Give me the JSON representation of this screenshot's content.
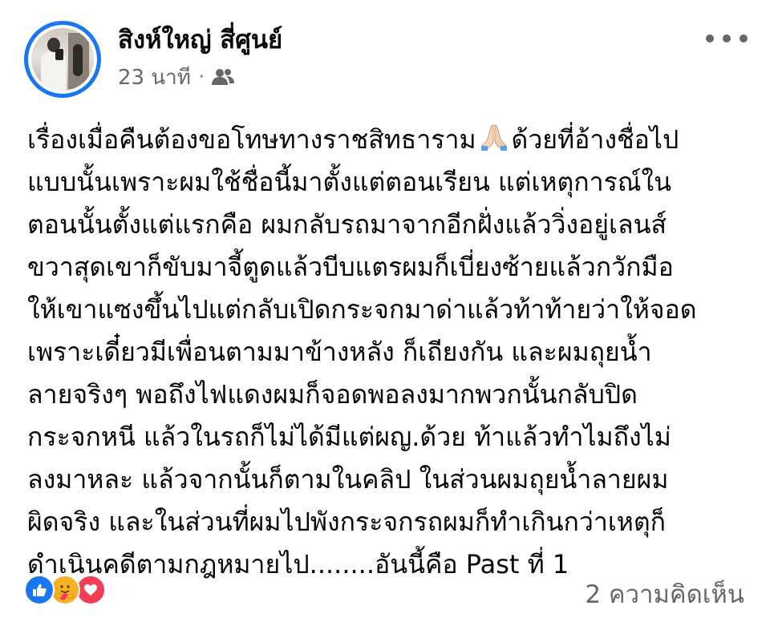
{
  "post": {
    "author": "สิงห์ใหญ่ สี่ศูนย์",
    "time": "23 นาที",
    "separator": "·",
    "audience_icon": "friends-icon",
    "more_icon": "more-horizontal-icon",
    "lines": [
      {
        "before": "เรื่องเมื่อคืนต้องขอโทษทางราชสิทธาราม",
        "emoji": "folded-hands-icon",
        "after": "ด้วยที่อ้างชื่อไป"
      },
      {
        "text": "แบบนั้นเพราะผมใช้ชื่อนี้มาตั้งแต่ตอนเรียน แต่เหตุการณ์ใน"
      },
      {
        "text": "ตอนนั้นตั้งแต่แรกคือ ผมกลับรถมาจากอีกฝั่งแล้ววิ่งอยู่เลนส์"
      },
      {
        "text": "ขวาสุดเขาก็ขับมาจี้ตูดแล้วบีบแตรผมก็เบี่ยงซ้ายแล้วกวักมือ"
      },
      {
        "text": "ให้เขาแซงขึ้นไปแต่กลับเปิดกระจกมาด่าแล้วท้าท้ายว่าให้จอด"
      },
      {
        "text": "เพราะเดี๋ยวมีเพื่อนตามมาข้างหลัง ก็เถียงกัน และผมถุยน้ำ"
      },
      {
        "text": "ลายจริงๆ พอถึงไฟแดงผมก็จอดพอลงมากพวกนั้นกลับปิด"
      },
      {
        "text": "กระจกหนี แล้วในรถก็ไม่ได้มีแต่ผญ.ด้วย ท้าแล้วทำไมถึงไม่"
      },
      {
        "text": "ลงมาหละ แล้วจากนั้นก็ตามในคลิป ในส่วนผมถุยน้ำลายผม"
      },
      {
        "text": "ผิดจริง และในส่วนที่ผมไปพังกระจกรถผมก็ทำเกินกว่าเหตุก็"
      },
      {
        "text": "ดำเนินคดีตามกฎหมายไป........อันนี้คือ Past ที่ 1"
      }
    ],
    "reactions": [
      "like-icon",
      "care-icon",
      "love-icon"
    ],
    "comment_count": "2 ความคิดเห็น"
  },
  "colors": {
    "accent": "#1877f2",
    "text": "#050505",
    "secondary_text": "#65676b",
    "like": "#1877f2",
    "care": "#f7b125",
    "love": "#f33e58"
  }
}
